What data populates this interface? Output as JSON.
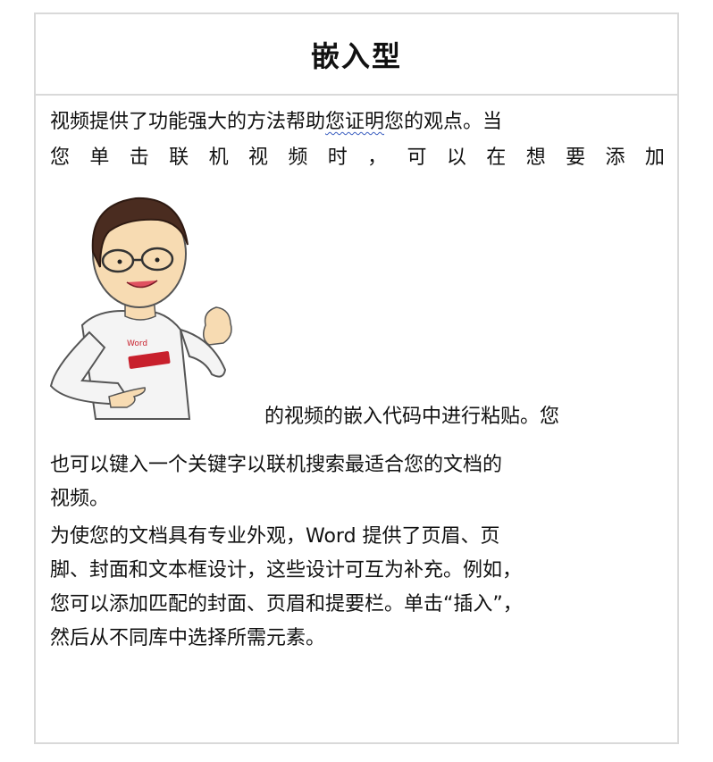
{
  "title": "嵌入型",
  "para1": {
    "line1_a": "视频提供了功能强大的方法帮助",
    "line1_squiggle": "您证明",
    "line1_b": "您的观点。当",
    "line2_chars": [
      "您",
      "单",
      "击",
      "联",
      "机",
      "视",
      "频",
      "时",
      "，",
      "可",
      "以",
      "在",
      "想",
      "要",
      "添",
      "加"
    ],
    "line3": "的视频的嵌入代码中进行粘贴。您",
    "line4": "也可以键入一个关键字以联机搜索最适合您的文档的",
    "line5": "视频。"
  },
  "para2": {
    "line1": "为使您的文档具有专业外观，Word  提供了页眉、页",
    "line2": "脚、封面和文本框设计，这些设计可互为补充。例如，",
    "line3": "您可以添加匹配的封面、页眉和提要栏。单击“插入”，",
    "line4": "然后从不同库中选择所需元素。"
  },
  "illustration": {
    "icon": "cartoon-man-pointing-at-word-shirt",
    "shirt_text": "Word"
  }
}
